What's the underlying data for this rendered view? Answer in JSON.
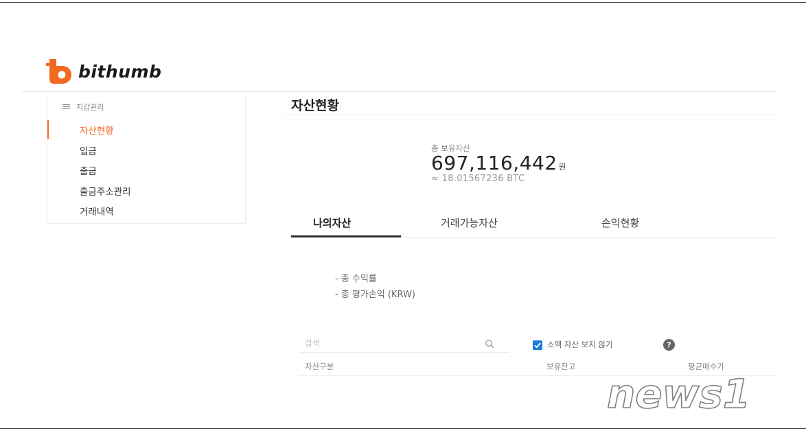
{
  "brand": {
    "name": "bithumb",
    "color": "#f26a21"
  },
  "sidebar": {
    "header": "지갑관리",
    "items": [
      {
        "label": "자산현황",
        "active": true
      },
      {
        "label": "입금",
        "active": false
      },
      {
        "label": "출금",
        "active": false
      },
      {
        "label": "출금주소관리",
        "active": false
      },
      {
        "label": "거래내역",
        "active": false
      }
    ]
  },
  "main": {
    "title": "자산현황",
    "total": {
      "label": "총 보유자산",
      "amount": "697,116,442",
      "unit": "원",
      "btc": "≈ 18.01567236 BTC"
    },
    "tabs": [
      {
        "label": "나의자산",
        "active": true
      },
      {
        "label": "거래가능자산",
        "active": false
      },
      {
        "label": "손익현황",
        "active": false
      }
    ],
    "summary": [
      "- 총 수익률",
      "- 총 평가손익 (KRW)"
    ],
    "search": {
      "placeholder": "검색",
      "value": ""
    },
    "hide_small": {
      "label": "소액 자산 보지 않기",
      "checked": true,
      "color": "#1f7bd8"
    },
    "help_label": "?",
    "table": {
      "columns": [
        "자산구분",
        "보유잔고",
        "평균매수가"
      ]
    }
  },
  "watermark": {
    "text": "news1"
  }
}
